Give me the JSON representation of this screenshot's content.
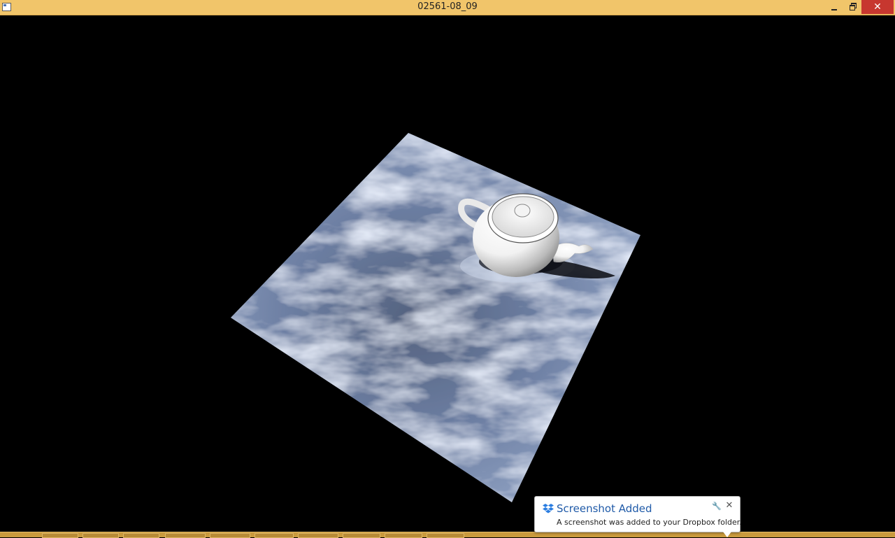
{
  "window": {
    "title": "02561-08_09",
    "close_glyph": "✕",
    "titlebar_color": "#f1c56a",
    "close_color": "#c7372f"
  },
  "viewport": {
    "background": "#000000",
    "scene": {
      "floor_color": "#7d90b4",
      "teapot_color": "#ffffff"
    }
  },
  "notification": {
    "title": "Screenshot Added",
    "message": "A screenshot was added to your Dropbox folder.",
    "icon": "dropbox-icon",
    "settings_glyph": "🔧",
    "close_glyph": "✕",
    "title_color": "#1f5aa8"
  },
  "taskbar": {
    "color": "#c99a3d"
  }
}
